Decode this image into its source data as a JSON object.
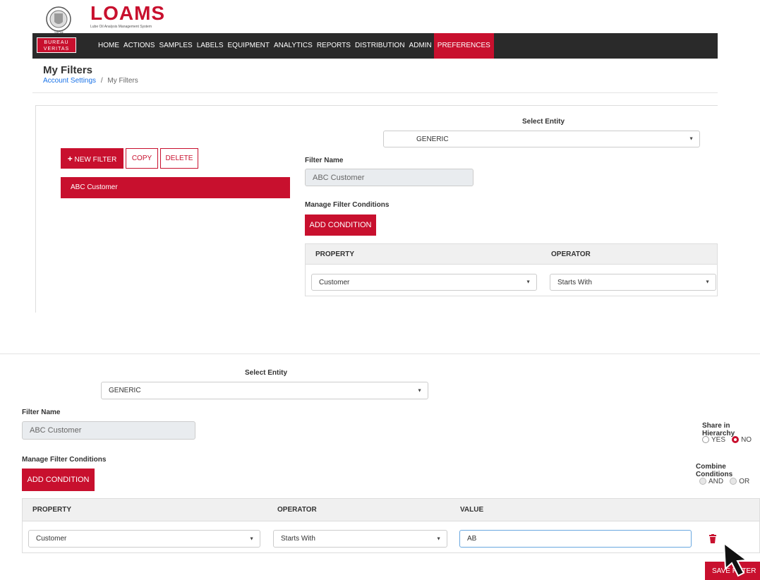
{
  "header": {
    "bv_badge_line1": "BUREAU",
    "bv_badge_line2": "VERITAS",
    "bv_seal_text": "1828",
    "app_name": "LOAMS",
    "app_tagline": "Lube Oil Analysis Management System"
  },
  "nav": {
    "items": [
      "HOME",
      "ACTIONS",
      "SAMPLES",
      "LABELS",
      "EQUIPMENT",
      "ANALYTICS",
      "REPORTS",
      "DISTRIBUTION",
      "ADMIN",
      "PREFERENCES"
    ],
    "active": "PREFERENCES"
  },
  "page": {
    "title": "My Filters",
    "breadcrumb_link": "Account Settings",
    "breadcrumb_sep": "/",
    "breadcrumb_current": "My Filters"
  },
  "filters_panel": {
    "new_filter_label": "NEW FILTER",
    "copy_label": "COPY",
    "delete_label": "DELETE",
    "items": [
      "ABC Customer"
    ]
  },
  "form": {
    "select_entity_label": "Select Entity",
    "entity_value": "GENERIC",
    "filter_name_label": "Filter Name",
    "filter_name_value": "ABC Customer",
    "manage_conditions_label": "Manage Filter Conditions",
    "add_condition_label": "ADD CONDITION",
    "col_property": "PROPERTY",
    "col_operator": "OPERATOR",
    "col_value": "VALUE",
    "row_property": "Customer",
    "row_operator": "Starts With",
    "row_value": "AB",
    "share_label": "Share in Hierarchy",
    "share_yes": "YES",
    "share_no": "NO",
    "share_selected": "NO",
    "combine_label": "Combine Conditions",
    "combine_and": "AND",
    "combine_or": "OR",
    "save_label": "SAVE FILTER"
  },
  "colors": {
    "brand_red": "#c8102e",
    "nav_dark": "#2a2a2a",
    "link_blue": "#1a73e8"
  }
}
